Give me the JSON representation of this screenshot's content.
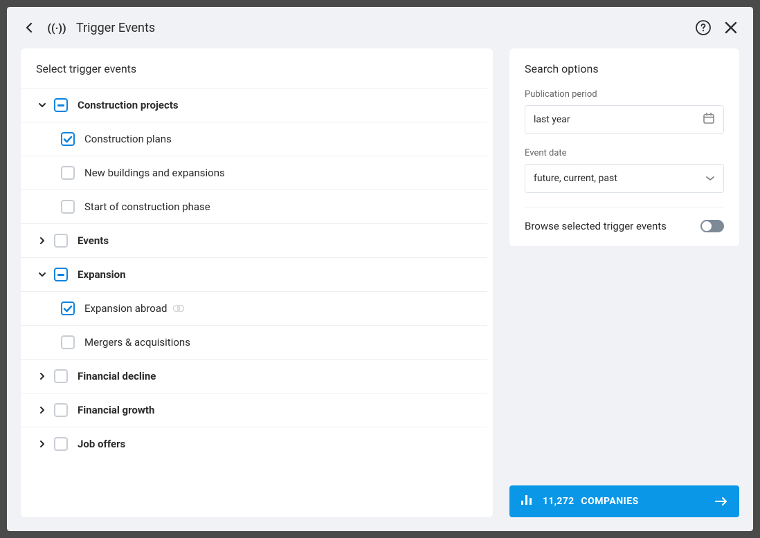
{
  "header": {
    "title": "Trigger Events"
  },
  "leftPanel": {
    "title": "Select trigger events"
  },
  "tree": {
    "categories": [
      {
        "label": "Construction projects",
        "expanded": true,
        "state": "indeterminate",
        "children": [
          {
            "label": "Construction plans",
            "checked": true
          },
          {
            "label": "New buildings and expansions",
            "checked": false
          },
          {
            "label": "Start of construction phase",
            "checked": false
          }
        ]
      },
      {
        "label": "Events",
        "expanded": false,
        "state": "none",
        "children": []
      },
      {
        "label": "Expansion",
        "expanded": true,
        "state": "indeterminate",
        "children": [
          {
            "label": "Expansion abroad",
            "checked": true,
            "extra": true
          },
          {
            "label": "Mergers & acquisitions",
            "checked": false
          }
        ]
      },
      {
        "label": "Financial decline",
        "expanded": false,
        "state": "none",
        "children": []
      },
      {
        "label": "Financial growth",
        "expanded": false,
        "state": "none",
        "children": []
      },
      {
        "label": "Job offers",
        "expanded": false,
        "state": "none",
        "children": []
      }
    ]
  },
  "options": {
    "title": "Search options",
    "publicationPeriod": {
      "label": "Publication period",
      "value": "last year"
    },
    "eventDate": {
      "label": "Event date",
      "value": "future, current, past"
    },
    "browseToggle": {
      "label": "Browse selected trigger events",
      "enabled": false
    }
  },
  "results": {
    "count": "11,272",
    "label": "COMPANIES"
  }
}
